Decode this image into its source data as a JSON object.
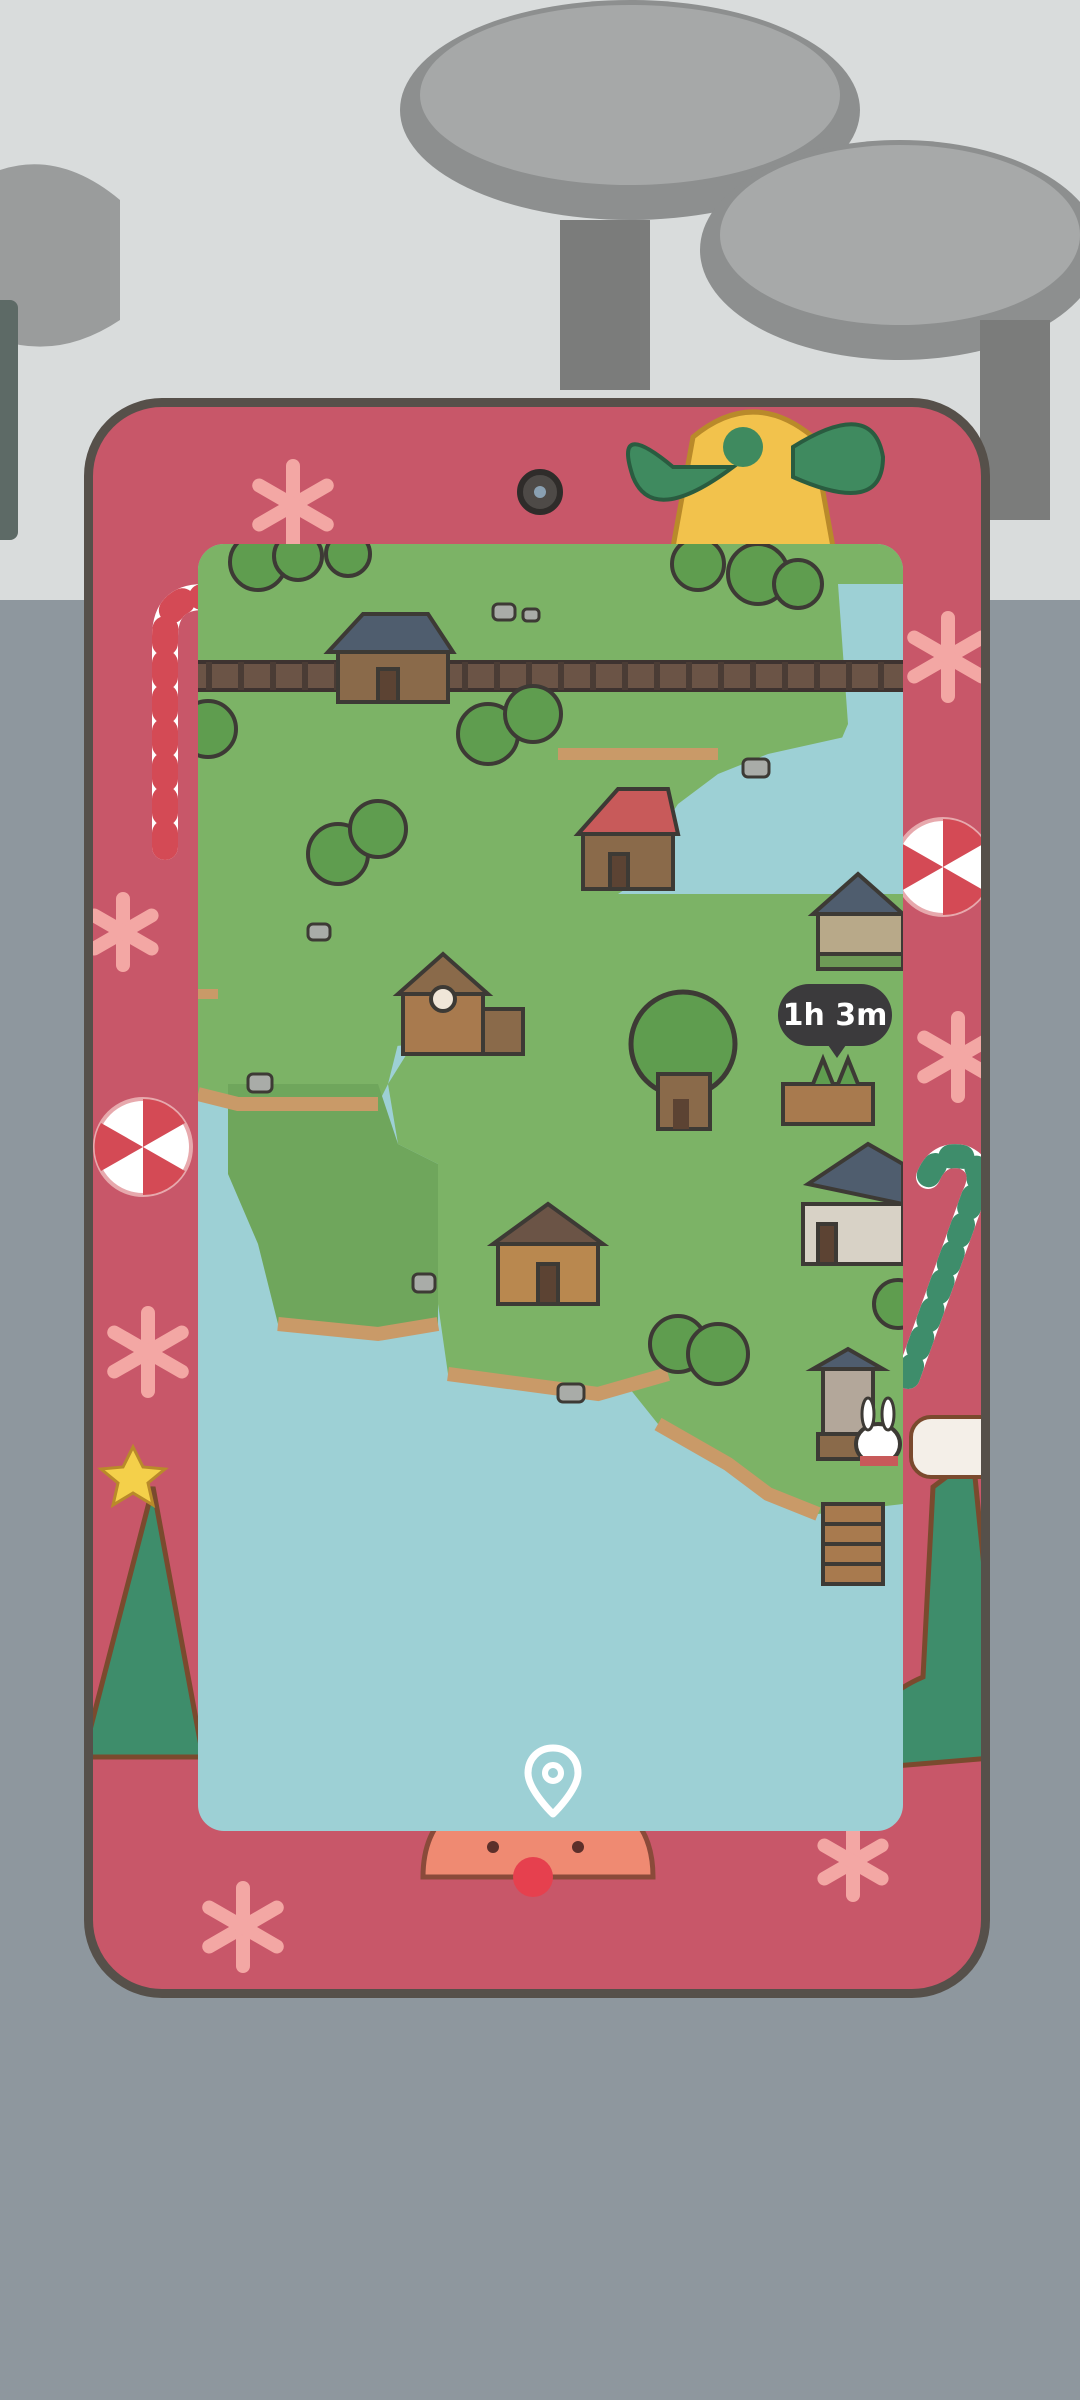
{
  "map": {
    "timer_label": "1h 3m"
  },
  "icons": {
    "locate": "map-pin-icon",
    "camera": "camera-icon"
  },
  "colors": {
    "frame": "#c85769",
    "frame_border": "#56504a",
    "grass": "#7cb366",
    "water": "#9dd0d5",
    "timer_bg": "#3b3a3c"
  }
}
